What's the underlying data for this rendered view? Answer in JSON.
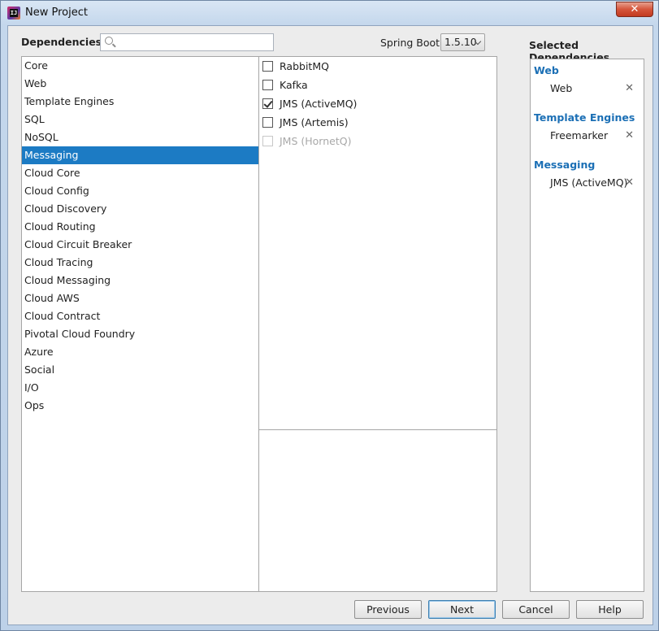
{
  "window": {
    "title": "New Project",
    "close_glyph": "✕"
  },
  "header": {
    "dependencies_label": "Dependencies",
    "search_placeholder": "",
    "spring_boot_label": "Spring Boot",
    "spring_boot_version": "1.5.10",
    "selected_title": "Selected Dependencies"
  },
  "categories": [
    {
      "label": "Core"
    },
    {
      "label": "Web"
    },
    {
      "label": "Template Engines"
    },
    {
      "label": "SQL"
    },
    {
      "label": "NoSQL"
    },
    {
      "label": "Messaging",
      "active": true
    },
    {
      "label": "Cloud Core"
    },
    {
      "label": "Cloud Config"
    },
    {
      "label": "Cloud Discovery"
    },
    {
      "label": "Cloud Routing"
    },
    {
      "label": "Cloud Circuit Breaker"
    },
    {
      "label": "Cloud Tracing"
    },
    {
      "label": "Cloud Messaging"
    },
    {
      "label": "Cloud AWS"
    },
    {
      "label": "Cloud Contract"
    },
    {
      "label": "Pivotal Cloud Foundry"
    },
    {
      "label": "Azure"
    },
    {
      "label": "Social"
    },
    {
      "label": "I/O"
    },
    {
      "label": "Ops"
    }
  ],
  "options": [
    {
      "label": "RabbitMQ",
      "checked": false,
      "disabled": false
    },
    {
      "label": "Kafka",
      "checked": false,
      "disabled": false
    },
    {
      "label": "JMS (ActiveMQ)",
      "checked": true,
      "disabled": false
    },
    {
      "label": "JMS (Artemis)",
      "checked": false,
      "disabled": false
    },
    {
      "label": "JMS (HornetQ)",
      "checked": false,
      "disabled": true
    }
  ],
  "selected": [
    {
      "group": "Web",
      "items": [
        "Web"
      ]
    },
    {
      "group": "Template Engines",
      "items": [
        "Freemarker"
      ]
    },
    {
      "group": "Messaging",
      "items": [
        "JMS (ActiveMQ)"
      ]
    }
  ],
  "remove_glyph": "✕",
  "buttons": {
    "previous": "Previous",
    "next": "Next",
    "cancel": "Cancel",
    "help": "Help"
  },
  "colors": {
    "accent": "#1c7bc4",
    "group_title": "#1b6fb5"
  },
  "icons": {
    "app": "intellij-idea-icon",
    "search": "search-icon",
    "dropdown": "chevron-down-icon",
    "remove": "close-icon"
  }
}
